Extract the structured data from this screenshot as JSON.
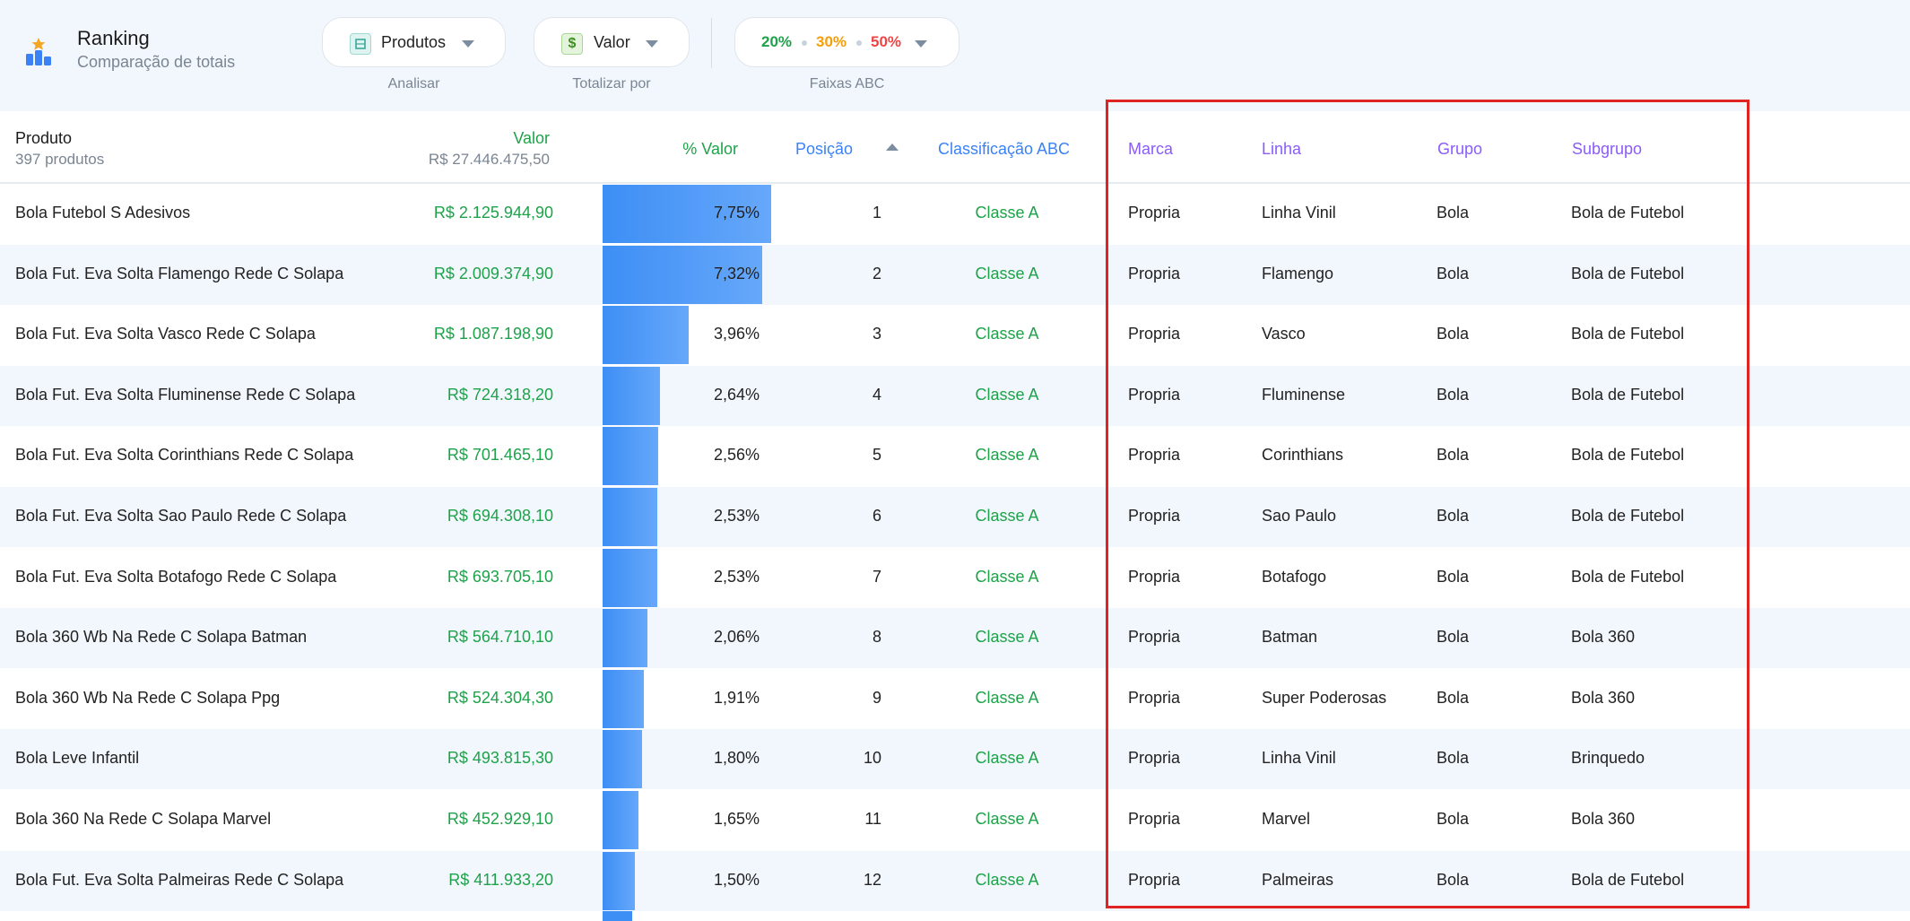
{
  "header": {
    "title": "Ranking",
    "subtitle": "Comparação de totais"
  },
  "controls": {
    "analyze": {
      "value": "Produtos",
      "label": "Analisar"
    },
    "total_by": {
      "value": "Valor",
      "label": "Totalizar por",
      "icon_glyph": "$"
    },
    "abc": {
      "a": "20%",
      "b": "30%",
      "c": "50%",
      "label": "Faixas ABC"
    }
  },
  "colors": {
    "green": "#1ea24a",
    "orange": "#f59e0b",
    "red": "#ef4444",
    "blue": "#3b82f6",
    "purple": "#8b5cf6",
    "highlight_border": "#e02424"
  },
  "table": {
    "columns": {
      "produto": "Produto",
      "produto_count": "397 produtos",
      "valor": "Valor",
      "valor_total": "R$ 27.446.475,50",
      "pct_valor": "% Valor",
      "posicao": "Posição",
      "classificacao": "Classificação ABC",
      "marca": "Marca",
      "linha": "Linha",
      "grupo": "Grupo",
      "subgrupo": "Subgrupo"
    },
    "rows": [
      {
        "produto": "Bola Futebol S  Adesivos",
        "valor": "R$ 2.125.944,90",
        "pct": "7,75%",
        "pct_num": 7.75,
        "pos": "1",
        "cls": "Classe A",
        "marca": "Propria",
        "linha": "Linha Vinil",
        "grupo": "Bola",
        "subgrupo": "Bola de Futebol"
      },
      {
        "produto": "Bola Fut. Eva Solta Flamengo Rede C  Solapa",
        "valor": "R$ 2.009.374,90",
        "pct": "7,32%",
        "pct_num": 7.32,
        "pos": "2",
        "cls": "Classe A",
        "marca": "Propria",
        "linha": "Flamengo",
        "grupo": "Bola",
        "subgrupo": "Bola de Futebol"
      },
      {
        "produto": "Bola Fut. Eva Solta Vasco Rede C  Solapa",
        "valor": "R$ 1.087.198,90",
        "pct": "3,96%",
        "pct_num": 3.96,
        "pos": "3",
        "cls": "Classe A",
        "marca": "Propria",
        "linha": "Vasco",
        "grupo": "Bola",
        "subgrupo": "Bola de Futebol"
      },
      {
        "produto": "Bola Fut. Eva Solta Fluminense Rede C  Solapa",
        "valor": "R$ 724.318,20",
        "pct": "2,64%",
        "pct_num": 2.64,
        "pos": "4",
        "cls": "Classe A",
        "marca": "Propria",
        "linha": "Fluminense",
        "grupo": "Bola",
        "subgrupo": "Bola de Futebol"
      },
      {
        "produto": "Bola Fut. Eva Solta Corinthians Rede C  Solapa",
        "valor": "R$ 701.465,10",
        "pct": "2,56%",
        "pct_num": 2.56,
        "pos": "5",
        "cls": "Classe A",
        "marca": "Propria",
        "linha": "Corinthians",
        "grupo": "Bola",
        "subgrupo": "Bola de Futebol"
      },
      {
        "produto": "Bola Fut. Eva Solta Sao Paulo Rede C  Solapa",
        "valor": "R$ 694.308,10",
        "pct": "2,53%",
        "pct_num": 2.53,
        "pos": "6",
        "cls": "Classe A",
        "marca": "Propria",
        "linha": "Sao Paulo",
        "grupo": "Bola",
        "subgrupo": "Bola de Futebol"
      },
      {
        "produto": "Bola Fut. Eva Solta Botafogo Rede C  Solapa",
        "valor": "R$ 693.705,10",
        "pct": "2,53%",
        "pct_num": 2.53,
        "pos": "7",
        "cls": "Classe A",
        "marca": "Propria",
        "linha": "Botafogo",
        "grupo": "Bola",
        "subgrupo": "Bola de Futebol"
      },
      {
        "produto": "Bola 360 Wb Na Rede C  Solapa Batman",
        "valor": "R$ 564.710,10",
        "pct": "2,06%",
        "pct_num": 2.06,
        "pos": "8",
        "cls": "Classe A",
        "marca": "Propria",
        "linha": "Batman",
        "grupo": "Bola",
        "subgrupo": "Bola 360"
      },
      {
        "produto": "Bola 360 Wb Na Rede C  Solapa Ppg",
        "valor": "R$ 524.304,30",
        "pct": "1,91%",
        "pct_num": 1.91,
        "pos": "9",
        "cls": "Classe A",
        "marca": "Propria",
        "linha": "Super Poderosas",
        "grupo": "Bola",
        "subgrupo": "Bola 360"
      },
      {
        "produto": "Bola Leve Infantil",
        "valor": "R$ 493.815,30",
        "pct": "1,80%",
        "pct_num": 1.8,
        "pos": "10",
        "cls": "Classe A",
        "marca": "Propria",
        "linha": "Linha Vinil",
        "grupo": "Bola",
        "subgrupo": "Brinquedo"
      },
      {
        "produto": "Bola 360  Na Rede C  Solapa Marvel",
        "valor": "R$ 452.929,10",
        "pct": "1,65%",
        "pct_num": 1.65,
        "pos": "11",
        "cls": "Classe A",
        "marca": "Propria",
        "linha": "Marvel",
        "grupo": "Bola",
        "subgrupo": "Bola 360"
      },
      {
        "produto": "Bola Fut. Eva Solta Palmeiras Rede C  Solapa",
        "valor": "R$ 411.933,20",
        "pct": "1,50%",
        "pct_num": 1.5,
        "pos": "12",
        "cls": "Classe A",
        "marca": "Propria",
        "linha": "Palmeiras",
        "grupo": "Bola",
        "subgrupo": "Bola de Futebol"
      }
    ]
  }
}
